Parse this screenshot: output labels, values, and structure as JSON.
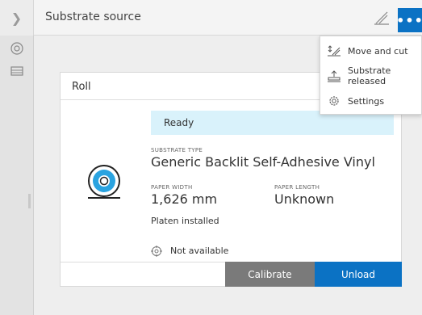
{
  "header": {
    "title": "Substrate source"
  },
  "menu": {
    "items": [
      {
        "label": "Move and cut",
        "icon": "move-cut-icon"
      },
      {
        "label": "Substrate released",
        "icon": "substrate-release-icon"
      },
      {
        "label": "Settings",
        "icon": "gear-icon"
      }
    ]
  },
  "card": {
    "title": "Roll",
    "status": "Ready",
    "substrate_type_label": "SUBSTRATE TYPE",
    "substrate_type_value": "Generic Backlit Self-Adhesive Vinyl",
    "paper_width_label": "PAPER WIDTH",
    "paper_width_value": "1,626 mm",
    "paper_length_label": "PAPER LENGTH",
    "paper_length_value": "Unknown",
    "platen": "Platen installed",
    "calibration": "Not available",
    "calibrate_label": "Calibrate",
    "unload_label": "Unload"
  },
  "colors": {
    "accent": "#0b72c4",
    "status_bg": "#d9f2fb",
    "disabled_btn": "#7a7a7a"
  }
}
